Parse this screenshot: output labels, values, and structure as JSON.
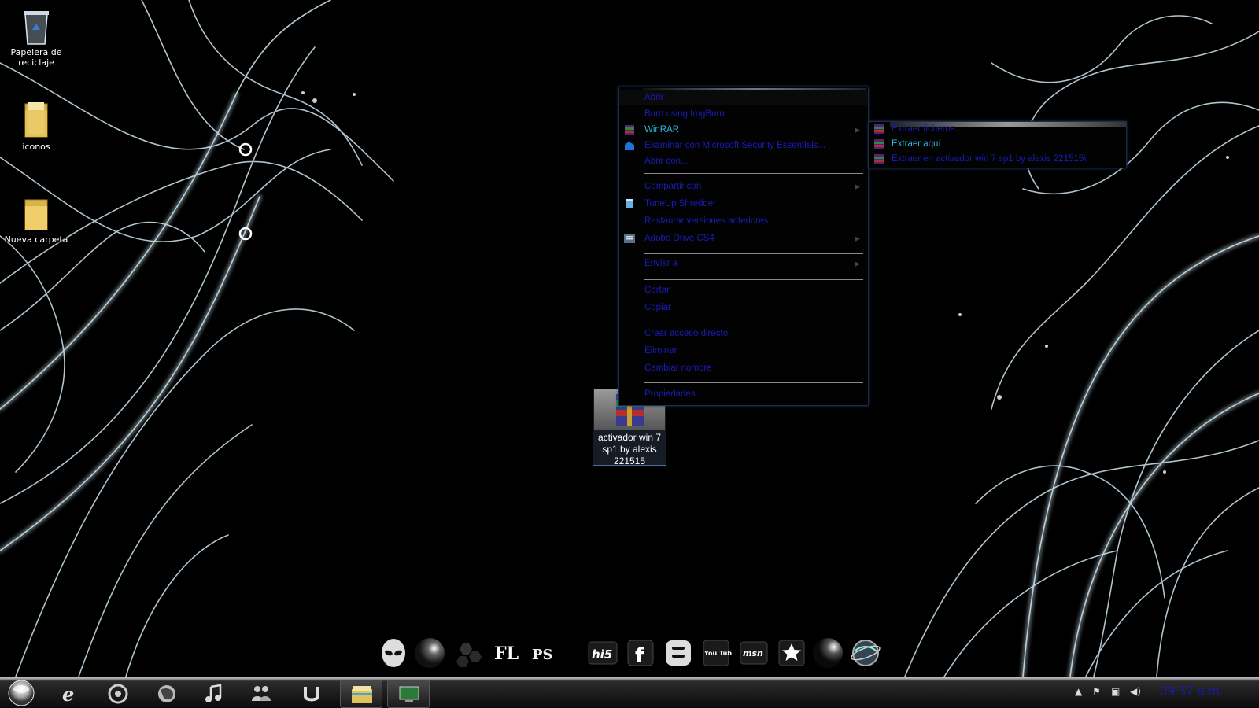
{
  "desktop": {
    "icons": [
      {
        "label": "Papelera de reciclaje",
        "icon": "recycle-bin-icon"
      },
      {
        "label": "iconos",
        "icon": "folder-icon"
      },
      {
        "label": "Nueva carpeta",
        "icon": "folder-icon"
      }
    ],
    "selected_file": {
      "label": "activador win 7 sp1 by alexis 221515",
      "icon": "winrar-archive-icon"
    }
  },
  "context_menu": {
    "items": [
      {
        "label": "Abrir"
      },
      {
        "label": "Burn using ImgBurn"
      },
      {
        "label": "WinRAR",
        "icon": "winrar-icon",
        "submenu": true
      },
      {
        "label": "Examinar con Microsoft Security Essentials...",
        "icon": "security-essentials-icon"
      },
      {
        "label": "Abrir con..."
      },
      {
        "label": "Compartir con",
        "submenu": true
      },
      {
        "label": "TuneUp Shredder",
        "icon": "trash-icon"
      },
      {
        "label": "Restaurar versiones anteriores"
      },
      {
        "label": "Adobe Drive CS4",
        "icon": "adobe-drive-icon",
        "submenu": true
      },
      {
        "label": "Enviar a",
        "submenu": true
      },
      {
        "label": "Cortar"
      },
      {
        "label": "Copiar"
      },
      {
        "label": "Crear acceso directo"
      },
      {
        "label": "Eliminar"
      },
      {
        "label": "Cambiar nombre"
      },
      {
        "label": "Propiedades"
      }
    ]
  },
  "winrar_submenu": {
    "items": [
      {
        "label": "Extraer ficheros..."
      },
      {
        "label": "Extraer aquí"
      },
      {
        "label": "Extraer en activador win 7 sp1 by alexis 221515\\"
      }
    ]
  },
  "dock": {
    "icons": [
      "alien-icon",
      "orb-icon",
      "hexagons-icon",
      "fl-studio-icon",
      "photoshop-icon",
      "hi5-icon",
      "facebook-icon",
      "blogger-icon",
      "youtube-icon",
      "msn-icon",
      "star-icon",
      "moon-orb-icon",
      "globe-icon"
    ],
    "labels": {
      "fl": "FL",
      "ps": "PS",
      "hi5": "hi5",
      "facebook": "f",
      "youtube": "You Tube",
      "msn": "msn"
    }
  },
  "taskbar": {
    "buttons": [
      "start-orb-icon",
      "internet-explorer-icon",
      "chrome-icon",
      "firefox-icon",
      "music-icon",
      "messenger-icon",
      "utorrent-icon",
      "explorer-icon",
      "computer-icon"
    ],
    "clock": "09:57 a.m."
  },
  "colors": {
    "menu_text": "#1b1bb8",
    "menu_highlight_text": "#2cb8d8",
    "clock": "#1a1aa8"
  }
}
